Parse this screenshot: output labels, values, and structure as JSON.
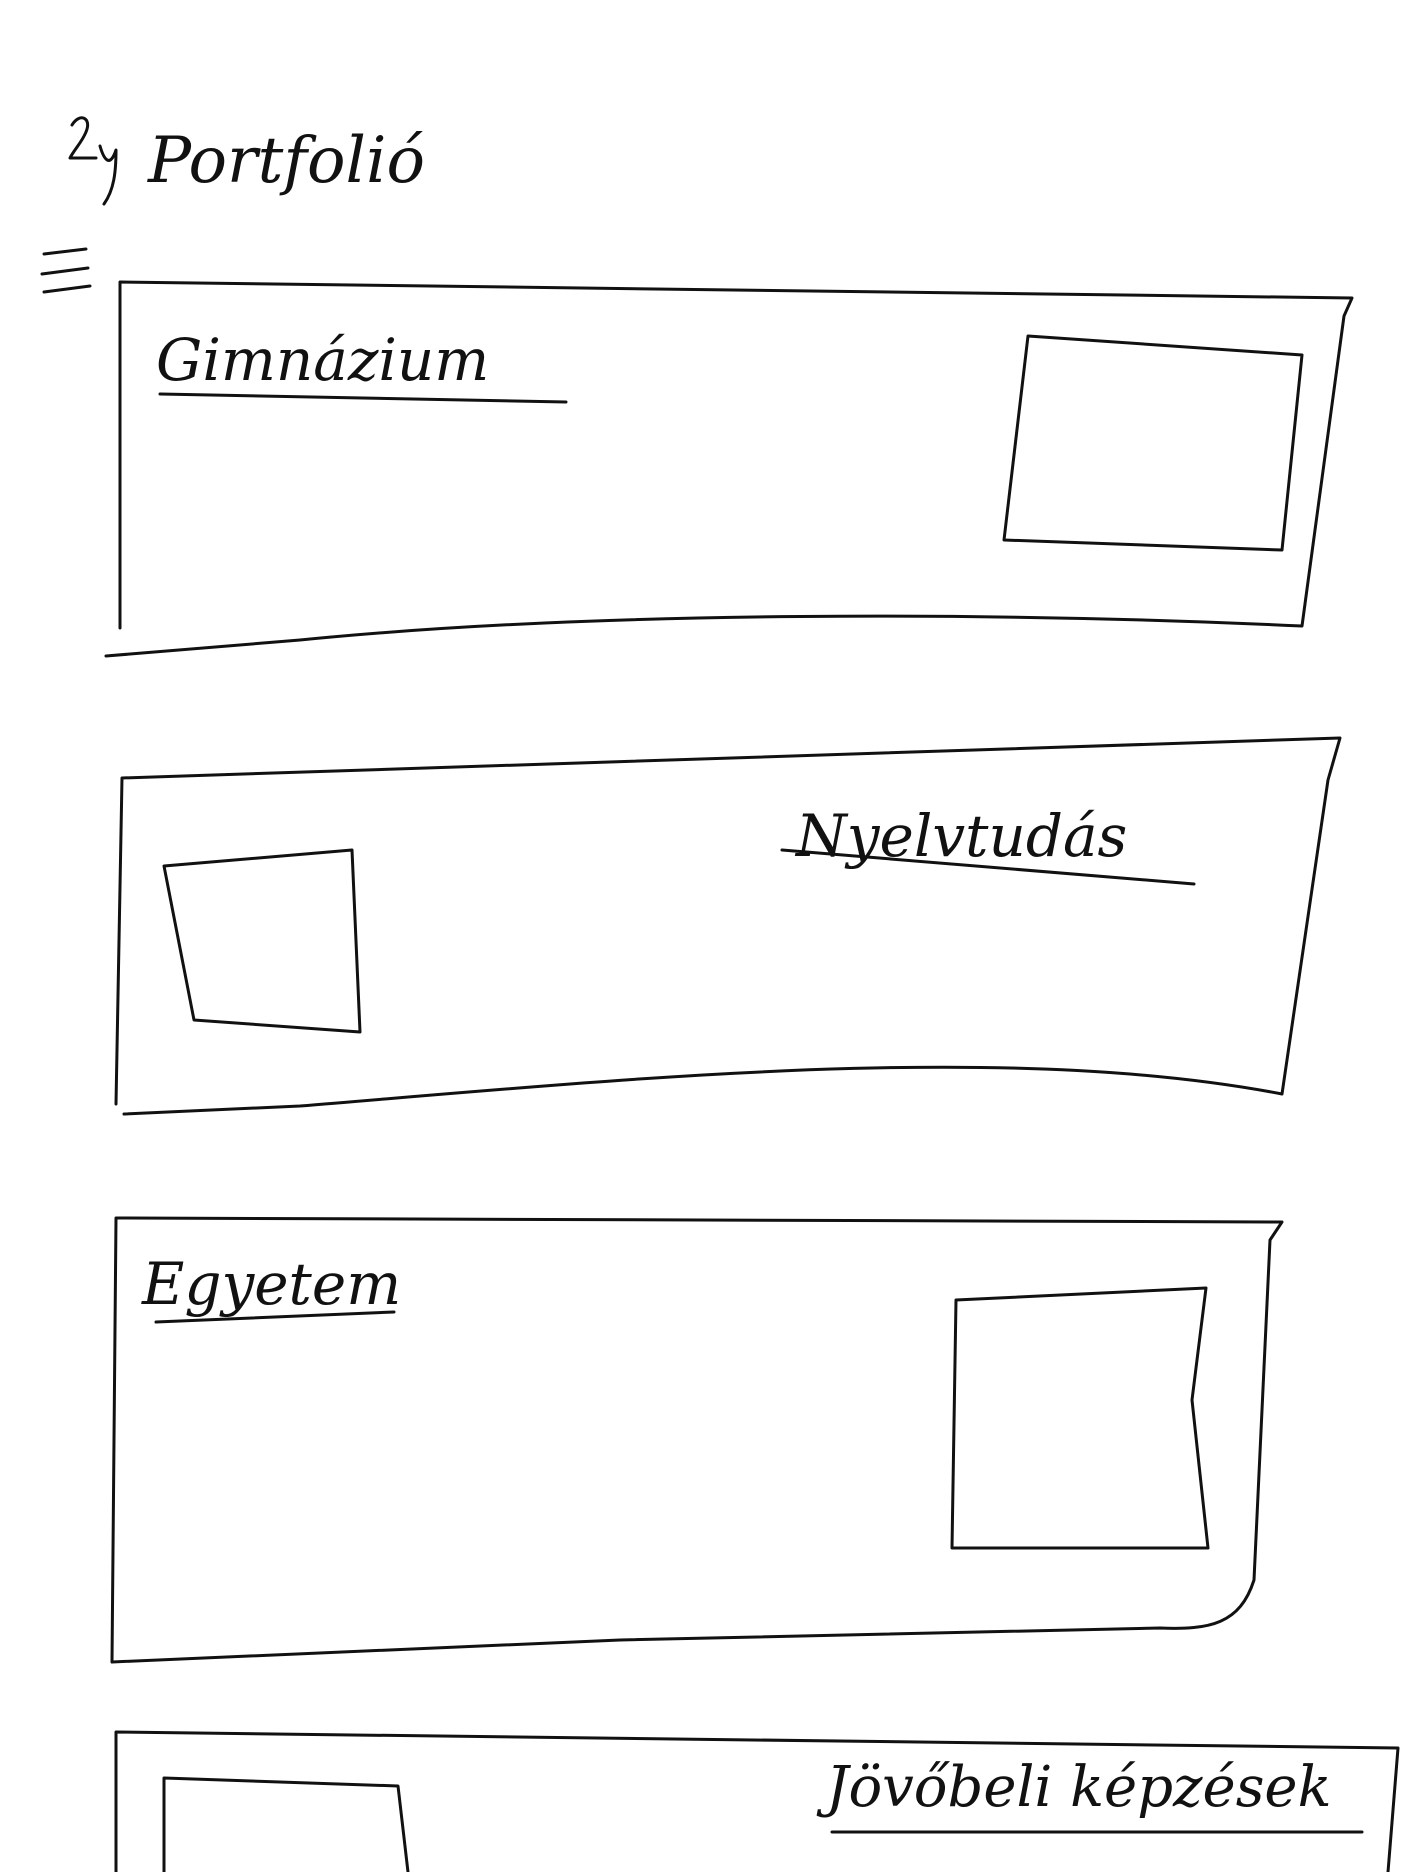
{
  "header": {
    "title": "Portfolió",
    "menu_icon": "hamburger-menu-icon"
  },
  "sections": [
    {
      "title": "Gimnázium",
      "image_icon": "image-placeholder-icon"
    },
    {
      "title": "Nyelvtudás",
      "image_icon": "image-placeholder-icon"
    },
    {
      "title": "Egyetem",
      "image_icon": "image-placeholder-icon"
    },
    {
      "title": "Jövőbeli képzések",
      "image_icon": "image-placeholder-icon"
    }
  ]
}
